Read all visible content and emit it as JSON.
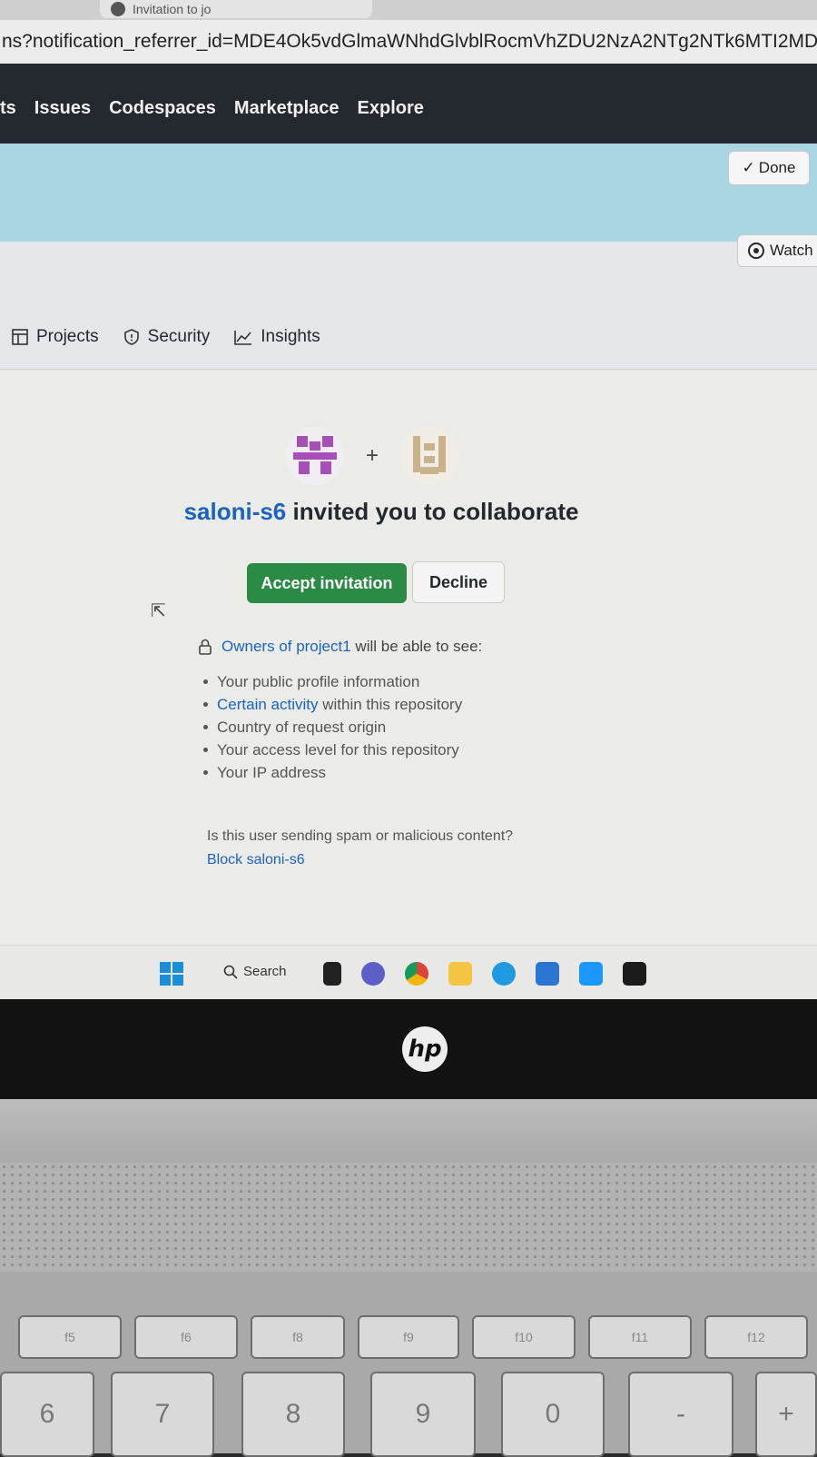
{
  "browser": {
    "tab_title": "Invitation to jo",
    "url": "ns?notification_referrer_id=MDE4Ok5vdGlmaWNhdGlvblRocmVhZDU2NzA2NTg2NTk6MTI2MDQzNTQx"
  },
  "gh_nav": [
    "ts",
    "Issues",
    "Codespaces",
    "Marketplace",
    "Explore"
  ],
  "banner": {
    "done_label": "Done"
  },
  "repo": {
    "watch_label": "Watch",
    "tabs": [
      "Projects",
      "Security",
      "Insights"
    ]
  },
  "invite": {
    "inviter": "saloni-s6",
    "message": " invited you to collaborate",
    "accept_label": "Accept invitation",
    "decline_label": "Decline",
    "owners_prefix": "Owners of project1",
    "owners_suffix": " will be able to see:",
    "permissions": [
      "Your public profile information",
      "Certain activity",
      " within this repository",
      "Country of request origin",
      "Your access level for this repository",
      "Your IP address"
    ],
    "spam_question": "Is this user sending spam or malicious content?",
    "block_label": "Block saloni-s6"
  },
  "taskbar": {
    "search_label": "Search"
  },
  "laptop": {
    "brand": "hp",
    "fkeys": [
      "f5",
      "f6",
      "f8",
      "f9",
      "f10",
      "f11",
      "f12"
    ],
    "number_keys": [
      "6",
      "7",
      "8",
      "9",
      "0",
      "-",
      "+"
    ]
  },
  "colors": {
    "accept": "#2c8a47",
    "link": "#1a63c5",
    "header": "#24292f"
  }
}
